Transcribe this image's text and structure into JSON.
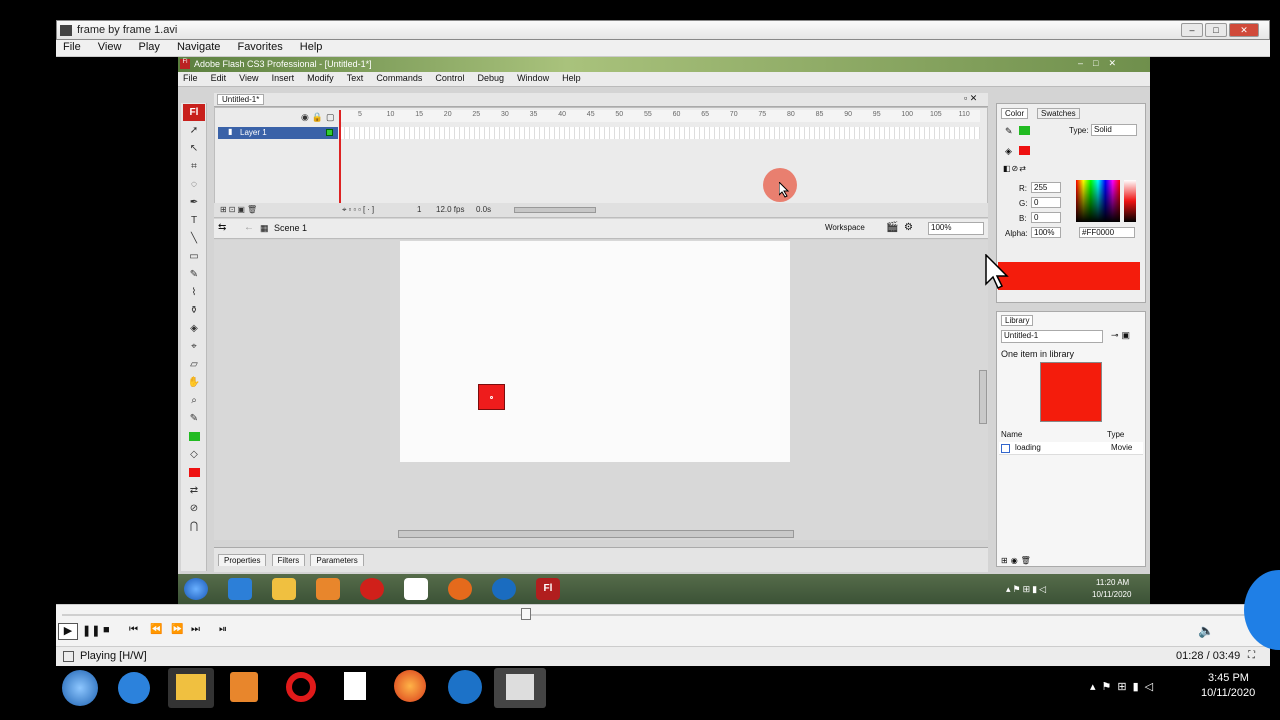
{
  "player": {
    "title": "frame by frame 1.avi",
    "menu": [
      "File",
      "View",
      "Play",
      "Navigate",
      "Favorites",
      "Help"
    ],
    "status": "Playing [H/W]",
    "time": "01:28 / 03:49"
  },
  "flash": {
    "title": "Adobe Flash CS3 Professional - [Untitled-1*]",
    "menu": [
      "File",
      "Edit",
      "View",
      "Insert",
      "Modify",
      "Text",
      "Commands",
      "Control",
      "Debug",
      "Window",
      "Help"
    ],
    "doc_tab": "Untitled-1*",
    "layer_name": "Layer 1",
    "ruler": [
      "5",
      "10",
      "15",
      "20",
      "25",
      "30",
      "35",
      "40",
      "45",
      "50",
      "55",
      "60",
      "65",
      "70",
      "75",
      "80",
      "85",
      "90",
      "95",
      "100",
      "105",
      "110"
    ],
    "frame": "1",
    "fps": "12.0 fps",
    "time": "0.0s",
    "scene": "Scene 1",
    "workspace": "Workspace",
    "zoom": "100%",
    "panel_tabs": [
      "Properties",
      "Filters",
      "Parameters"
    ],
    "tool_logo": "Fl"
  },
  "color_panel": {
    "tabs": [
      "Color",
      "Swatches"
    ],
    "type_label": "Type:",
    "type_value": "Solid",
    "r_label": "R:",
    "r": "255",
    "g_label": "G:",
    "g": "0",
    "b_label": "B:",
    "b": "0",
    "alpha_label": "Alpha:",
    "alpha": "100%",
    "hex": "#FF0000"
  },
  "library": {
    "tab": "Library",
    "doc": "Untitled-1",
    "count": "One item in library",
    "col_name": "Name",
    "col_type": "Type",
    "item_name": "loading",
    "item_type": "Movie"
  },
  "inner_taskbar": {
    "time": "11:20 AM",
    "date": "10/11/2020",
    "app_label": "Fl"
  },
  "taskbar": {
    "time": "3:45 PM",
    "date": "10/11/2020"
  },
  "colors": {
    "accent_red": "#f41c0c",
    "fill_green": "#22bb22"
  }
}
